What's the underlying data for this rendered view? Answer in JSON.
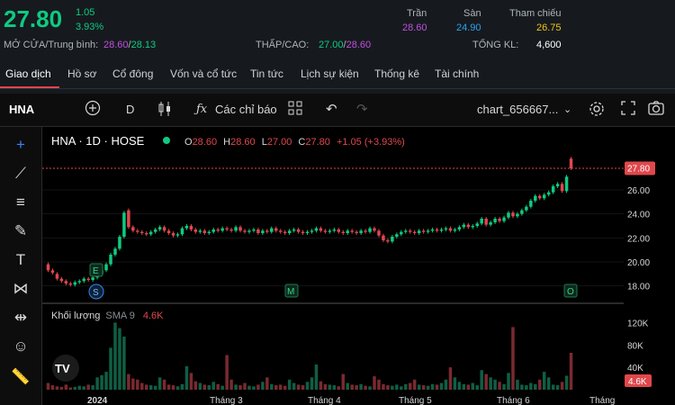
{
  "quote": {
    "price": "27.80",
    "change": "1.05",
    "change_pct": "3.93%",
    "open_label": "MỞ CỬA/Trung bình:",
    "open": "28.60",
    "average": "28.13",
    "lowhigh_label": "THẤP/CAO:",
    "low": "27.00",
    "high": "28.60",
    "ceiling_label": "Trần",
    "ceiling": "28.60",
    "floor_label": "Sàn",
    "floor": "24.90",
    "reference_label": "Tham chiếu",
    "reference": "26.75",
    "volume_label": "TỔNG KL:",
    "volume": "4,600",
    "colors": {
      "up": "#0ecb81",
      "ceiling": "#c24fe0",
      "floor": "#2ea3f2",
      "reference": "#f0c419",
      "down": "#e0474c"
    }
  },
  "tabs": [
    "Giao dịch",
    "Hồ sơ",
    "Cổ đông",
    "Vốn và cổ tức",
    "Tin tức",
    "Lịch sự kiện",
    "Thống kê",
    "Tài chính"
  ],
  "toolbar": {
    "symbol": "HNA",
    "interval": "D",
    "indicators_label": "Các chỉ báo",
    "layout_name": "chart_656667...",
    "icons": [
      "plus-circle-icon",
      "candles-icon",
      "fx-icon",
      "templates-icon",
      "undo-icon",
      "redo-icon",
      "settings-icon",
      "fullscreen-icon",
      "camera-icon"
    ]
  },
  "left_tools": [
    "crosshair-icon",
    "trendline-icon",
    "fib-icon",
    "brush-icon",
    "text-icon",
    "pattern-icon",
    "forecast-icon",
    "emoji-icon",
    "ruler-icon"
  ],
  "legend": {
    "title": "HNA · 1D · HOSE",
    "o_label": "O",
    "o": "28.60",
    "h_label": "H",
    "h": "28.60",
    "l_label": "L",
    "l": "27.00",
    "c_label": "C",
    "c": "27.80",
    "change": "+1.05 (+3.93%)",
    "volume_label": "Khối lượng",
    "volume_sma": "SMA 9",
    "volume_value": "4.6K"
  },
  "markers": [
    "E",
    "S",
    "M",
    "O"
  ],
  "logo_text": "TV",
  "chart_data": {
    "type": "candlestick",
    "price_axis_ticks": [
      26.0,
      24.0,
      22.0,
      20.0,
      18.0
    ],
    "price_axis_labels": [
      "26.00",
      "24.00",
      "22.00",
      "20.00",
      "18.00"
    ],
    "last_price_label": "27.80",
    "volume_axis_ticks": [
      120000,
      80000,
      40000
    ],
    "volume_axis_labels": [
      "120K",
      "80K",
      "40K"
    ],
    "last_volume_label": "4.6K",
    "x_labels": [
      "2024",
      "Tháng 3",
      "Tháng 4",
      "Tháng 5",
      "Tháng 6",
      "Tháng"
    ],
    "price_range": [
      17.0,
      29.0
    ],
    "volume_range": [
      0,
      140000
    ],
    "closes": [
      19.3,
      19.1,
      18.6,
      18.4,
      18.2,
      18.1,
      18.3,
      18.4,
      18.6,
      18.5,
      18.7,
      19.0,
      19.3,
      19.8,
      20.6,
      21.1,
      22.1,
      24.1,
      22.9,
      22.6,
      22.5,
      22.4,
      22.3,
      22.5,
      22.7,
      22.9,
      22.6,
      22.4,
      22.2,
      22.3,
      22.8,
      23.0,
      22.7,
      22.5,
      22.6,
      22.4,
      22.5,
      22.7,
      22.6,
      22.8,
      22.7,
      22.6,
      22.9,
      22.6,
      22.5,
      22.6,
      22.7,
      22.4,
      22.6,
      22.5,
      22.8,
      22.6,
      22.5,
      22.4,
      22.6,
      22.7,
      22.5,
      22.4,
      22.5,
      22.6,
      22.8,
      22.6,
      22.5,
      22.6,
      22.7,
      22.5,
      22.4,
      22.6,
      22.5,
      22.4,
      22.6,
      22.5,
      22.8,
      22.6,
      22.2,
      21.8,
      21.7,
      22.1,
      22.3,
      22.5,
      22.6,
      22.5,
      22.4,
      22.6,
      22.5,
      22.6,
      22.7,
      22.6,
      22.7,
      22.8,
      22.6,
      22.7,
      22.9,
      23.1,
      22.9,
      23.0,
      23.2,
      23.6,
      23.1,
      23.3,
      23.6,
      23.4,
      23.7,
      24.1,
      23.8,
      24.0,
      24.3,
      24.6,
      25.1,
      25.5,
      25.3,
      25.6,
      25.8,
      26.3,
      26.5,
      25.9,
      27.1,
      27.8
    ],
    "opens": [
      19.8,
      19.3,
      19.0,
      18.6,
      18.4,
      18.2,
      18.1,
      18.3,
      18.4,
      18.6,
      18.5,
      18.7,
      19.0,
      19.3,
      19.8,
      20.6,
      21.1,
      22.1,
      24.3,
      22.9,
      22.6,
      22.5,
      22.4,
      22.3,
      22.5,
      22.7,
      22.9,
      22.6,
      22.4,
      22.2,
      22.3,
      22.8,
      23.0,
      22.7,
      22.5,
      22.6,
      22.4,
      22.5,
      22.7,
      22.6,
      22.8,
      22.7,
      22.6,
      22.9,
      22.6,
      22.5,
      22.6,
      22.7,
      22.4,
      22.6,
      22.5,
      22.8,
      22.6,
      22.5,
      22.4,
      22.6,
      22.7,
      22.5,
      22.4,
      22.5,
      22.6,
      22.8,
      22.6,
      22.5,
      22.6,
      22.7,
      22.5,
      22.4,
      22.6,
      22.5,
      22.4,
      22.6,
      22.5,
      22.8,
      22.6,
      22.2,
      21.8,
      21.7,
      22.1,
      22.3,
      22.5,
      22.6,
      22.5,
      22.4,
      22.6,
      22.5,
      22.6,
      22.7,
      22.6,
      22.7,
      22.8,
      22.6,
      22.7,
      22.9,
      23.1,
      22.9,
      23.0,
      23.2,
      23.6,
      23.1,
      23.3,
      23.6,
      23.4,
      23.7,
      24.1,
      23.8,
      24.0,
      24.3,
      24.6,
      25.1,
      25.5,
      25.3,
      25.6,
      25.8,
      26.3,
      26.5,
      25.9,
      28.6
    ],
    "volumes": [
      12000,
      8000,
      6000,
      5000,
      9000,
      4000,
      5000,
      7000,
      6000,
      9000,
      8000,
      22000,
      26000,
      32000,
      75000,
      120000,
      110000,
      95000,
      28000,
      20000,
      18000,
      12000,
      9000,
      8000,
      7000,
      22000,
      18000,
      9000,
      8000,
      6000,
      10000,
      42000,
      30000,
      15000,
      12000,
      9000,
      8000,
      14000,
      10000,
      7000,
      62000,
      18000,
      9000,
      8000,
      12000,
      7000,
      6000,
      9000,
      14000,
      22000,
      10000,
      8000,
      9000,
      7000,
      18000,
      12000,
      9000,
      8000,
      14000,
      22000,
      45000,
      15000,
      10000,
      9000,
      8000,
      6000,
      28000,
      12000,
      9000,
      8000,
      10000,
      7000,
      6000,
      24000,
      18000,
      10000,
      8000,
      7000,
      9000,
      6000,
      10000,
      12000,
      18000,
      9000,
      8000,
      7000,
      10000,
      9000,
      12000,
      18000,
      40000,
      22000,
      14000,
      10000,
      9000,
      12000,
      8000,
      35000,
      28000,
      22000,
      18000,
      14000,
      10000,
      30000,
      112000,
      18000,
      9000,
      8000,
      12000,
      10000,
      18000,
      32000,
      22000,
      9000,
      8000,
      14000,
      25000,
      66000,
      4600
    ]
  }
}
